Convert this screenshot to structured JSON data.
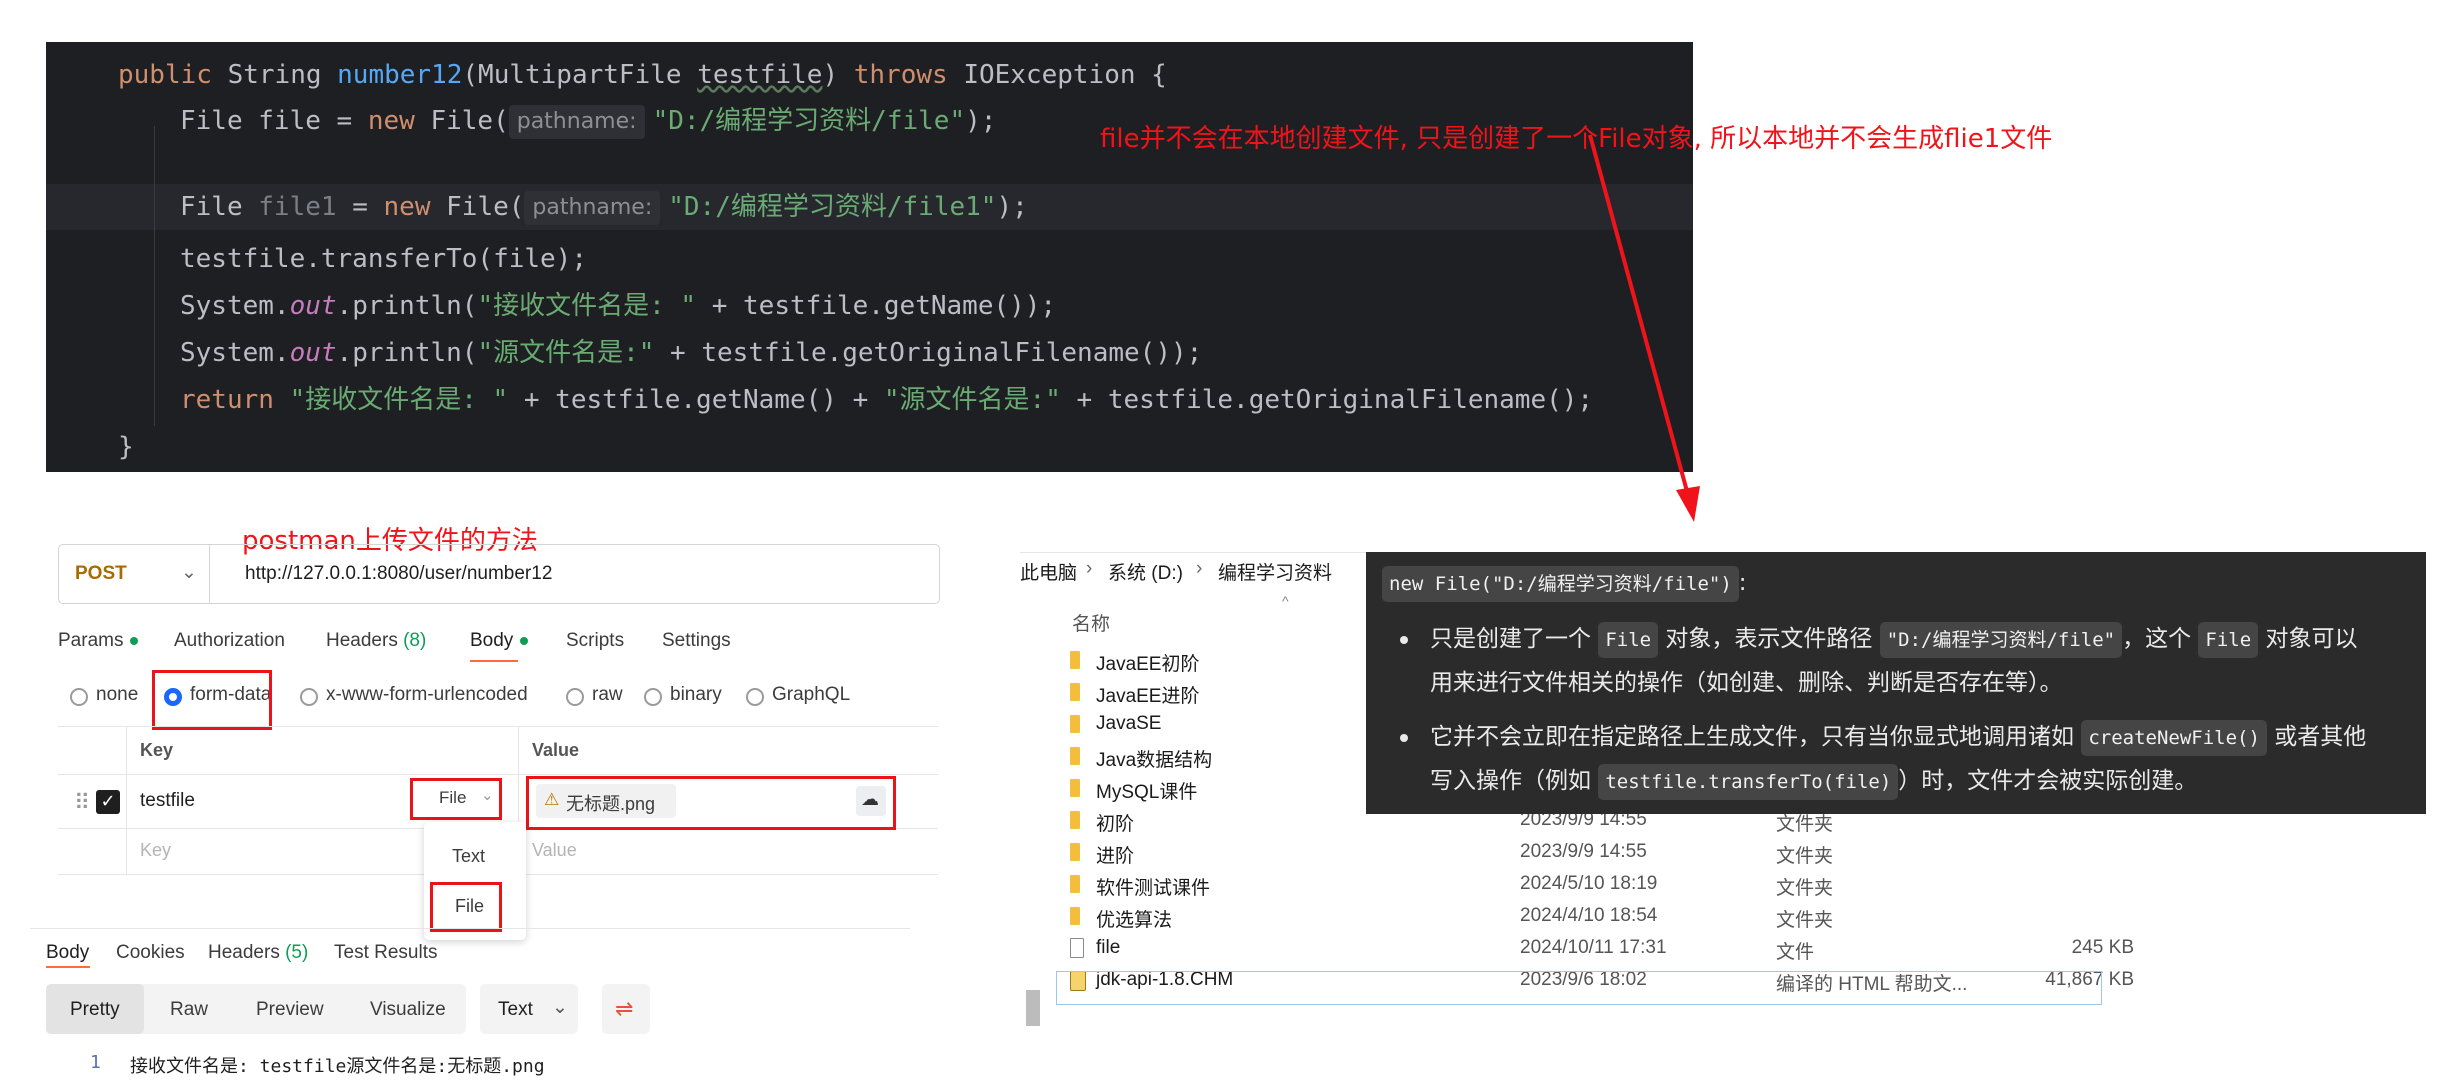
{
  "editor": {
    "lines": [
      {
        "t1": "public",
        "t2": " String ",
        "t3": "number12",
        "t4": "(MultipartFile ",
        "t5": "testfile",
        "t6": ") ",
        "t7": "throws",
        "t8": " IOException {"
      },
      {
        "t1": "File file = ",
        "t2": "new",
        "t3": " File(",
        "hint": "pathname:",
        "str": "\"D:/编程学习资料/file\"",
        "t4": ");"
      },
      {
        "t1": "File ",
        "t2": "file1",
        "t3": " = ",
        "t4": "new",
        "t5": " File(",
        "hint": "pathname:",
        "str": "\"D:/编程学习资料/file1\"",
        "t6": ");"
      },
      {
        "t1": "testfile.transferTo(file);"
      },
      {
        "t1": "System.",
        "t2": "out",
        "t3": ".println(",
        "str": "\"接收文件名是: \"",
        "t4": " + testfile.getName());"
      },
      {
        "t1": "System.",
        "t2": "out",
        "t3": ".println(",
        "str": "\"源文件名是:\"",
        "t4": " + testfile.getOriginalFilename());"
      },
      {
        "t1": "return",
        "str1": " \"接收文件名是: \"",
        "t2": " + testfile.getName() + ",
        "str2": "\"源文件名是:\"",
        "t3": " + testfile.getOriginalFilename();"
      },
      {
        "t1": "}"
      }
    ]
  },
  "annotations": {
    "file_note": "file并不会在本地创建文件, 只是创建了一个File对象, 所以本地并不会生成flie1文件",
    "postman_note": "postman上传文件的方法",
    "accent_red": "#f0141a"
  },
  "postman": {
    "method": "POST",
    "url": "http://127.0.0.1:8080/user/number12",
    "tabs": [
      "Params",
      "Authorization",
      "Headers",
      "(8)",
      "Body",
      "Scripts",
      "Settings"
    ],
    "body_types": [
      "none",
      "form-data",
      "x-www-form-urlencoded",
      "raw",
      "binary",
      "GraphQL"
    ],
    "table_headers": [
      "Key",
      "Value"
    ],
    "row_key": "testfile",
    "row_type": "File",
    "row_value": "无标题.png",
    "placeholder_key": "Key",
    "placeholder_value": "Value",
    "dropdown_options": [
      "Text",
      "File"
    ],
    "response_tabs": [
      "Body",
      "Cookies",
      "Headers",
      "(5)",
      "Test Results"
    ],
    "view_modes": [
      "Pretty",
      "Raw",
      "Preview",
      "Visualize"
    ],
    "format": "Text",
    "response_line_no": "1",
    "response_text": "接收文件名是: testfile源文件名是:无标题.png"
  },
  "explorer": {
    "breadcrumb": [
      "此电脑",
      "系统 (D:)",
      "编程学习资料"
    ],
    "column_name": "名称",
    "items": [
      {
        "name": "JavaEE初阶",
        "date": "",
        "type": "",
        "size": ""
      },
      {
        "name": "JavaEE进阶",
        "date": "",
        "type": "",
        "size": ""
      },
      {
        "name": "JavaSE",
        "date": "",
        "type": "",
        "size": ""
      },
      {
        "name": "Java数据结构",
        "date": "",
        "type": "",
        "size": ""
      },
      {
        "name": "MySQL课件",
        "date": "",
        "type": "",
        "size": ""
      },
      {
        "name": "初阶",
        "date": "2023/9/9 14:55",
        "type": "文件夹",
        "size": ""
      },
      {
        "name": "进阶",
        "date": "2023/9/9 14:55",
        "type": "文件夹",
        "size": ""
      },
      {
        "name": "软件测试课件",
        "date": "2024/5/10 18:19",
        "type": "文件夹",
        "size": ""
      },
      {
        "name": "优选算法",
        "date": "2024/4/10 18:54",
        "type": "文件夹",
        "size": ""
      },
      {
        "name": "file",
        "date": "2024/10/11 17:31",
        "type": "文件",
        "size": "245 KB"
      },
      {
        "name": "jdk-api-1.8.CHM",
        "date": "2023/9/6 18:02",
        "type": "编译的 HTML 帮助文...",
        "size": "41,867 KB"
      }
    ]
  },
  "popup": {
    "heading_code": "new File(\"D:/编程学习资料/file\")",
    "heading_suffix": ":",
    "b1_a": "只是创建了一个",
    "b1_code1": "File",
    "b1_b": "对象，表示文件路径",
    "b1_code2": "\"D:/编程学习资料/file\"",
    "b1_c": "，这个",
    "b1_code3": "File",
    "b1_d": "对象可以",
    "b1_line2": "用来进行文件相关的操作（如创建、删除、判断是否存在等）。",
    "b2_a": "它并不会立即在指定路径上生成文件，只有当你显式地调用诸如",
    "b2_code1": "createNewFile()",
    "b2_b": "或者其他",
    "b2_c": "写入操作（例如",
    "b2_code2": "testfile.transferTo(file)",
    "b2_d": "）时，文件才会被实际创建。"
  }
}
